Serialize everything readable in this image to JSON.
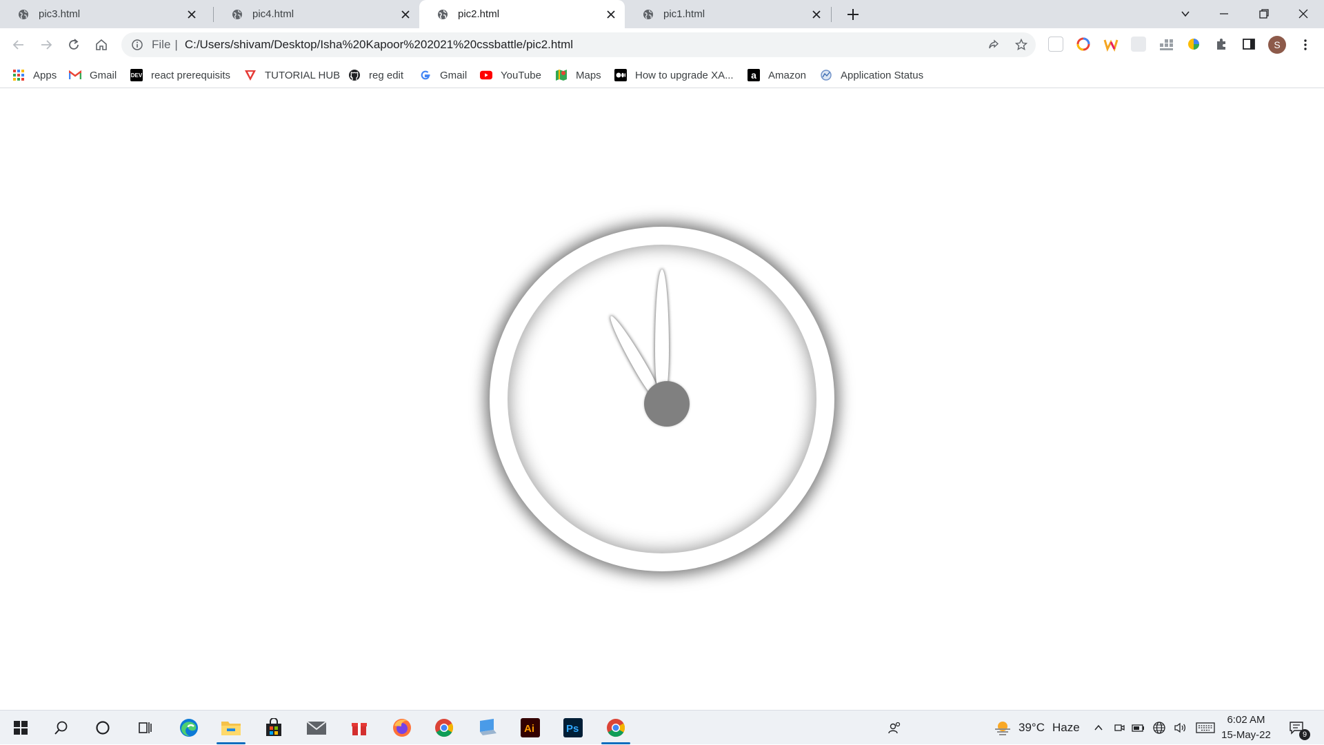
{
  "tabs": [
    {
      "title": "pic3.html",
      "active": false
    },
    {
      "title": "pic4.html",
      "active": false
    },
    {
      "title": "pic2.html",
      "active": true
    },
    {
      "title": "pic1.html",
      "active": false
    }
  ],
  "toolbar": {
    "scheme": "File",
    "pipe": "|",
    "url": "C:/Users/shivam/Desktop/Isha%20Kapoor%202021%20cssbattle/pic2.html",
    "profile_initial": "S"
  },
  "bookmarks": [
    {
      "label": "Apps",
      "icon": "apps-grid-icon"
    },
    {
      "label": "Gmail",
      "icon": "gmail-icon"
    },
    {
      "label": "react prerequisits",
      "icon": "dev-icon"
    },
    {
      "label": "TUTORIAL HUB",
      "icon": "tutorial-hub-icon"
    },
    {
      "label": "reg edit",
      "icon": "github-icon"
    },
    {
      "label": "Gmail",
      "icon": "google-icon"
    },
    {
      "label": "YouTube",
      "icon": "youtube-icon"
    },
    {
      "label": "Maps",
      "icon": "maps-icon"
    },
    {
      "label": "How to upgrade XA...",
      "icon": "medium-icon"
    },
    {
      "label": "Amazon",
      "icon": "amazon-icon"
    },
    {
      "label": "Application Status",
      "icon": "application-status-icon"
    }
  ],
  "page": {
    "clock": {
      "hour_hand_angle_deg": -30,
      "minute_hand_angle_deg": 0,
      "hub_color": "#808080"
    }
  },
  "taskbar": {
    "weather_temp": "39°C",
    "weather_text": "Haze",
    "time": "6:02 AM",
    "date": "15-May-22",
    "notification_count": "9"
  },
  "colors": {
    "tabstrip": "#dee1e6",
    "omnibox": "#f1f3f4",
    "taskbar": "#eef1f5",
    "accent": "#0f6cbd"
  }
}
